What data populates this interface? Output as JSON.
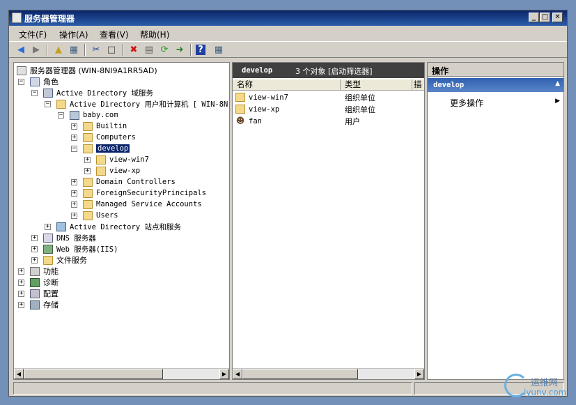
{
  "window": {
    "title": "服务器管理器",
    "controls": {
      "minimize": "_",
      "maximize": "□",
      "close": "✕"
    }
  },
  "menu": [
    "文件(F)",
    "操作(A)",
    "查看(V)",
    "帮助(H)"
  ],
  "toolbar": {
    "icons": [
      "back-arrow-icon",
      "forward-arrow-icon",
      "up-folder-icon",
      "show-tree-icon",
      "cut-icon",
      "copy-icon",
      "delete-icon",
      "properties-icon",
      "refresh-icon",
      "export-icon",
      "help-icon",
      "console-icon"
    ]
  },
  "tree": {
    "root": "服务器管理器 (WIN-8NI9A1RR5AD)",
    "roles": "角色",
    "ad_ds": "Active Directory 域服务",
    "ad_users": "Active Directory 用户和计算机 [ WIN-8N",
    "domain": "baby.com",
    "builtin": "Builtin",
    "computers": "Computers",
    "develop": "develop",
    "view_win7": "view-win7",
    "view_xp": "view-xp",
    "domain_controllers": "Domain Controllers",
    "foreign": "ForeignSecurityPrincipals",
    "managed": "Managed Service Accounts",
    "users": "Users",
    "ad_sites": "Active Directory 站点和服务",
    "dns": "DNS 服务器",
    "iis": "Web 服务器(IIS)",
    "file": "文件服务",
    "features": "功能",
    "diagnostics": "诊断",
    "config": "配置",
    "storage": "存储"
  },
  "middle": {
    "header_title": "develop",
    "header_info": "3 个对象 [启动筛选器]",
    "columns": [
      "名称",
      "类型",
      "描"
    ],
    "rows": [
      {
        "name": "view-win7",
        "type": "组织单位",
        "icon": "ou-icon"
      },
      {
        "name": "view-xp",
        "type": "组织单位",
        "icon": "ou-icon"
      },
      {
        "name": "fan",
        "type": "用户",
        "icon": "user-icon"
      }
    ]
  },
  "actions": {
    "header": "操作",
    "section": "develop",
    "more": "更多操作"
  },
  "watermark": {
    "brand": "运维网",
    "url": "iyunv.com"
  }
}
